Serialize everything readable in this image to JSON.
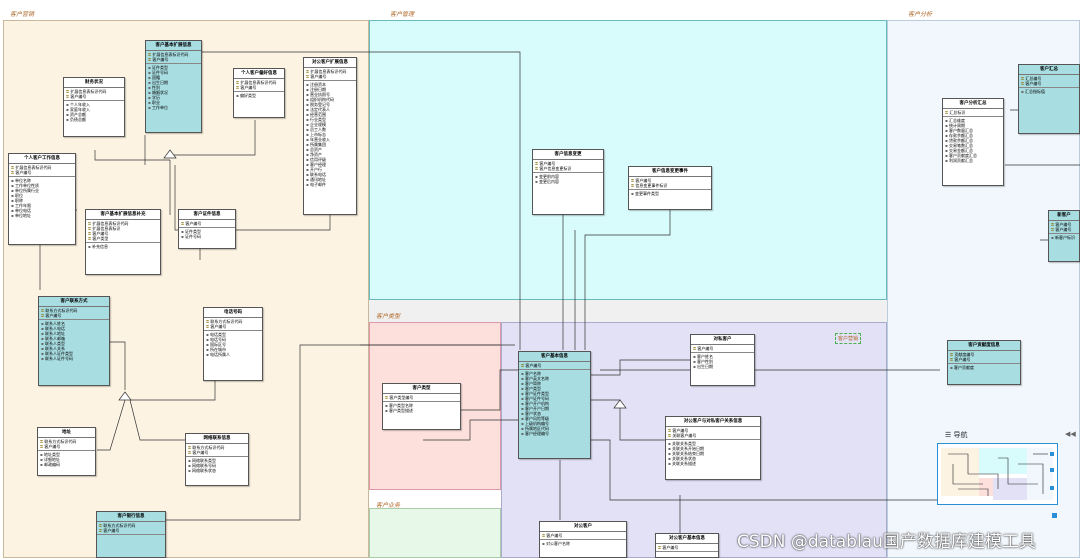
{
  "regions": {
    "r1": "客户营销",
    "r2": "客户管理",
    "r3": "客户分析",
    "r4": "客户类型",
    "r5": "客户类型",
    "r6": "客户业务",
    "r7": "客户营销"
  },
  "minimap": {
    "title": "导航",
    "collapse": "◀◀"
  },
  "watermark": "CSDN @datablau国产数据库建模工具",
  "entities": {
    "e_ext": {
      "title": "客户基本扩展信息",
      "keys": [
        "扩展信息表标识代码",
        "客户编号"
      ],
      "attrs": [
        "证件类型",
        "证件号码",
        "国籍",
        "出生日期",
        "性别",
        "婚姻状况",
        "学历",
        "职业",
        "工作单位"
      ]
    },
    "e_fin": {
      "title": "财务状况",
      "keys": [
        "扩展信息表标识代码",
        "客户编号"
      ],
      "attrs": [
        "个人年收入",
        "家庭年收入",
        "资产总额",
        "负债总额"
      ]
    },
    "e_pref": {
      "title": "个人客户偏好信息",
      "keys": [
        "扩展信息表标识代码",
        "客户编号"
      ],
      "attrs": [
        "偏好类型"
      ]
    },
    "e_corp": {
      "title": "对公客户扩展信息",
      "keys": [
        "扩展信息表标识代码",
        "客户编号"
      ],
      "attrs": [
        "注册资本",
        "注册日期",
        "营业执照号",
        "组织机构代码",
        "税务登记号",
        "法定代表人",
        "经营范围",
        "行业类型",
        "企业规模",
        "员工人数",
        "上市标志",
        "年营业收入",
        "所属集团",
        "总资产",
        "净资产",
        "信用评级",
        "客户经理",
        "开户行",
        "联系电话",
        "通讯地址",
        "电子邮件"
      ]
    },
    "e_work": {
      "title": "个人客户工作信息",
      "keys": [
        "扩展信息表标识代码",
        "客户编号"
      ],
      "attrs": [
        "单位名称",
        "工作单位性质",
        "单位所属行业",
        "职位",
        "职称",
        "工作年限",
        "单位电话",
        "单位地址"
      ]
    },
    "e_rel": {
      "title": "客户基本扩展信息补充",
      "keys": [
        "扩展信息表标识代码",
        "扩展信息表标识",
        "客户编号",
        "客户类型"
      ],
      "attrs": [
        "补充信息"
      ]
    },
    "e_id": {
      "title": "客户证件信息",
      "keys": [
        "客户编号"
      ],
      "attrs": [
        "证件类型",
        "证件号码"
      ]
    },
    "e_contact": {
      "title": "客户联系方式",
      "keys": [
        "联系方式标识代码",
        "客户编号"
      ],
      "attrs": [
        "联系人姓名",
        "联系人电话",
        "联系人地址",
        "联系人邮箱",
        "联系人类型",
        "联系人关系",
        "联系人证件类型",
        "联系人证件号码"
      ]
    },
    "e_phone": {
      "title": "电话号码",
      "keys": [
        "联系方式标识代码",
        "客户编号"
      ],
      "attrs": [
        "电话类型",
        "电话号码",
        "国际区号",
        "所在城市",
        "电话所属人"
      ]
    },
    "e_addr": {
      "title": "地址",
      "keys": [
        "联系方式标识代码",
        "客户编号"
      ],
      "attrs": [
        "地址类型",
        "详细地址",
        "邮政编码"
      ]
    },
    "e_net": {
      "title": "网络联系信息",
      "keys": [
        "联系方式标识代码",
        "客户编号"
      ],
      "attrs": [
        "网络联系类型",
        "网络联系号码",
        "网络联系状态"
      ]
    },
    "e_bank": {
      "title": "客户银行信息",
      "keys": [
        "联系方式标识代码",
        "客户编号"
      ],
      "attrs": []
    },
    "e_cinfo": {
      "title": "客户信息变更",
      "keys": [
        "客户编号",
        "客户信息变更标识"
      ],
      "attrs": [
        "变更前内容",
        "变更后内容"
      ]
    },
    "e_cchg": {
      "title": "客户信息变更事件",
      "keys": [
        "客户编号",
        "信息变更事件标识"
      ],
      "attrs": [
        "变更事件类型"
      ]
    },
    "e_main": {
      "title": "客户基本信息",
      "keys": [
        "客户编号"
      ],
      "attrs": [
        "客户名称",
        "客户英文名称",
        "客户简称",
        "客户类型",
        "客户证件类型",
        "客户证件号码",
        "客户开户机构",
        "客户开户日期",
        "客户状态",
        "客户风险等级",
        "上级机构编号",
        "所属地区代码",
        "客户经理编号"
      ]
    },
    "e_ctype": {
      "title": "客户类型",
      "keys": [
        "客户类型编号"
      ],
      "attrs": [
        "客户类型名称",
        "客户类型描述"
      ]
    },
    "e_comp": {
      "title": "对私客户",
      "keys": [
        "客户编号"
      ],
      "attrs": [
        "客户姓名",
        "客户性别",
        "出生日期"
      ]
    },
    "e_gov": {
      "title": "对公客户与对私客户关系信息",
      "keys": [
        "客户编号",
        "关联客户编号"
      ],
      "attrs": [
        "关联关系类型",
        "关联关系开始日期",
        "关联关系结束日期",
        "关联关系状态",
        "关联关系描述"
      ]
    },
    "e_ana": {
      "title": "客户分析汇总",
      "keys": [
        "汇总标识"
      ],
      "attrs": [
        "汇总维度",
        "统计周期",
        "客户数量汇总",
        "存款余额汇总",
        "贷款余额汇总",
        "交易笔数汇总",
        "交易金额汇总",
        "客户贡献度汇总",
        "利润贡献汇总"
      ]
    },
    "e_sum": {
      "title": "客户汇总",
      "keys": [
        "汇总编号",
        "客户编号"
      ],
      "attrs": [
        "汇总指标值"
      ]
    },
    "e_new": {
      "title": "新客户",
      "keys": [
        "客户编号",
        "客户编号"
      ],
      "attrs": [
        "新客户标识"
      ]
    },
    "e_ded": {
      "title": "客户贡献度信息",
      "keys": [
        "贡献度编号",
        "客户编号"
      ],
      "attrs": [
        "客户贡献度"
      ]
    },
    "e_priv": {
      "title": "对公客户",
      "keys": [
        "客户编号"
      ],
      "attrs": [
        "对公客户名称"
      ]
    },
    "e_biz": {
      "title": "对公客户基本信息",
      "keys": [
        "客户编号"
      ],
      "attrs": [
        "客户名称"
      ]
    }
  }
}
